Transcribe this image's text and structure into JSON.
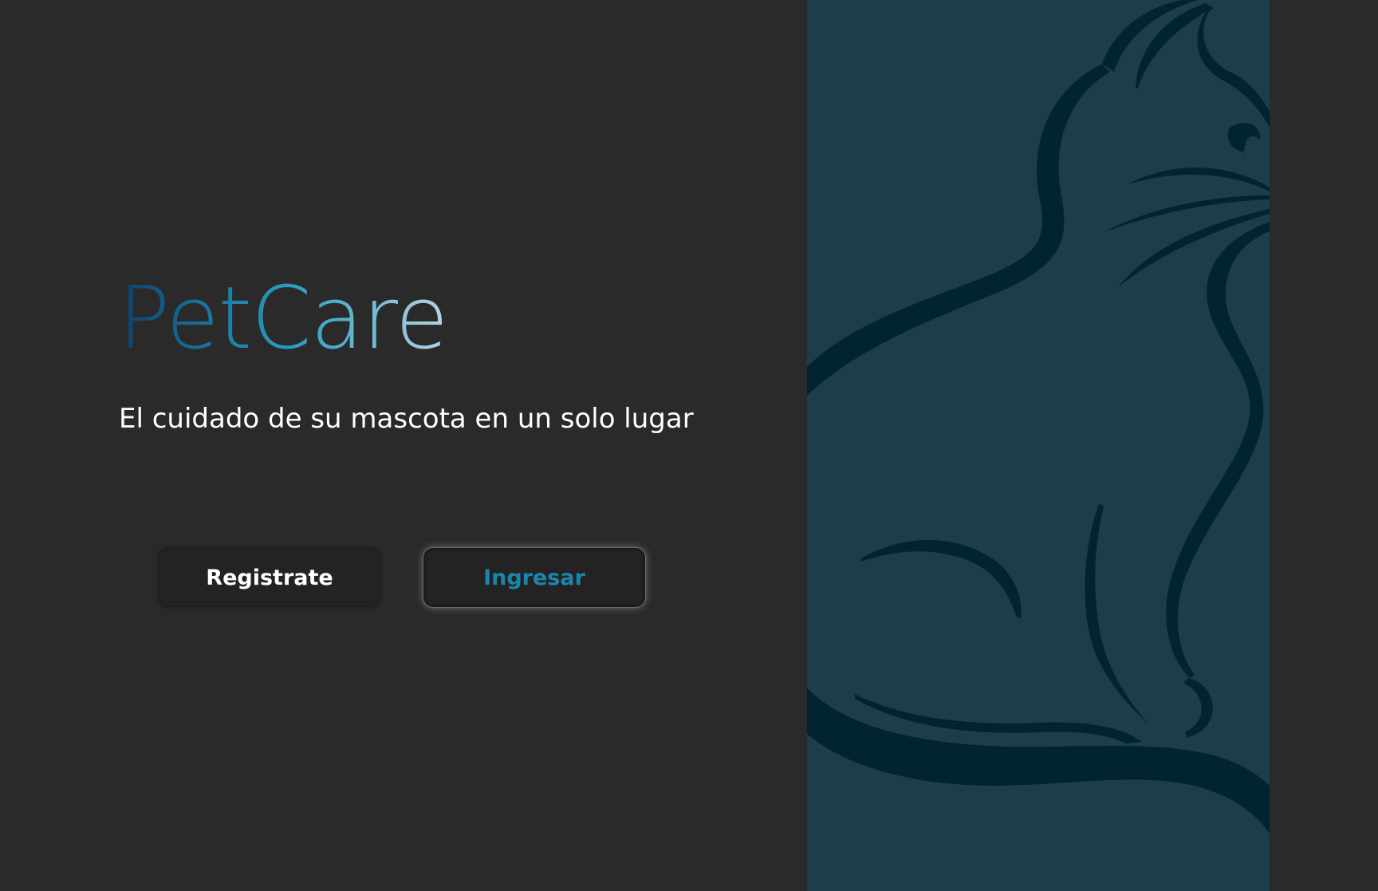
{
  "brand": {
    "name": "PetCare",
    "tagline": "El cuidado de su mascota en un solo lugar"
  },
  "actions": {
    "register_label": "Registrate",
    "login_label": "Ingresar"
  },
  "illustration": {
    "icon": "cat-silhouette-icon"
  },
  "colors": {
    "background": "#2a2a2a",
    "panel": "#1d3d4b",
    "cat_stroke": "#022330",
    "accent": "#1b86ad"
  }
}
